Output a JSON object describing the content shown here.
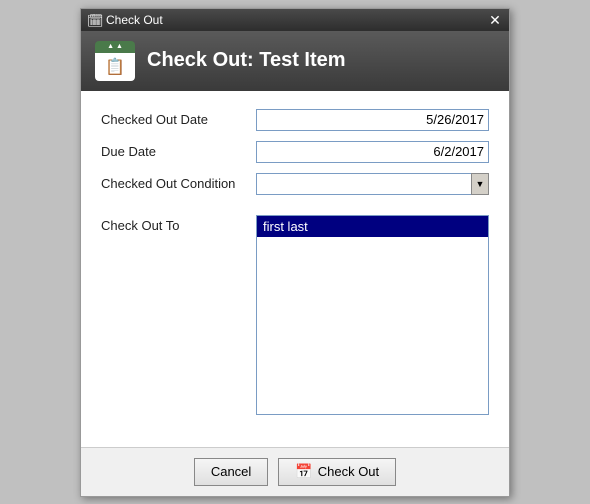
{
  "window": {
    "title": "Check Out",
    "close_label": "✕"
  },
  "header": {
    "title": "Check Out: Test Item",
    "icon_symbol": "📅"
  },
  "form": {
    "checked_out_date_label": "Checked Out Date",
    "checked_out_date_value": "5/26/2017",
    "due_date_label": "Due Date",
    "due_date_value": "6/2/2017",
    "checked_out_condition_label": "Checked Out Condition",
    "checked_out_condition_value": "",
    "check_out_to_label": "Check Out To",
    "check_out_to_items": [
      "first last"
    ]
  },
  "buttons": {
    "cancel_label": "Cancel",
    "checkout_label": "Check Out",
    "checkout_icon": "📅"
  }
}
